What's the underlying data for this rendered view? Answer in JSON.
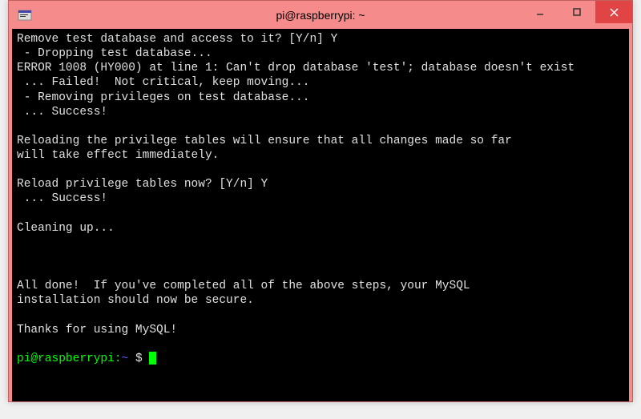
{
  "window": {
    "title": "pi@raspberrypi: ~"
  },
  "terminal": {
    "lines": [
      "Remove test database and access to it? [Y/n] Y",
      " - Dropping test database...",
      "ERROR 1008 (HY000) at line 1: Can't drop database 'test'; database doesn't exist",
      " ... Failed!  Not critical, keep moving...",
      " - Removing privileges on test database...",
      " ... Success!",
      "",
      "Reloading the privilege tables will ensure that all changes made so far",
      "will take effect immediately.",
      "",
      "Reload privilege tables now? [Y/n] Y",
      " ... Success!",
      "",
      "Cleaning up...",
      "",
      "",
      "",
      "All done!  If you've completed all of the above steps, your MySQL",
      "installation should now be secure.",
      "",
      "Thanks for using MySQL!",
      ""
    ],
    "prompt": {
      "user_host": "pi@raspberrypi",
      "path": "~",
      "symbol": "$"
    }
  }
}
